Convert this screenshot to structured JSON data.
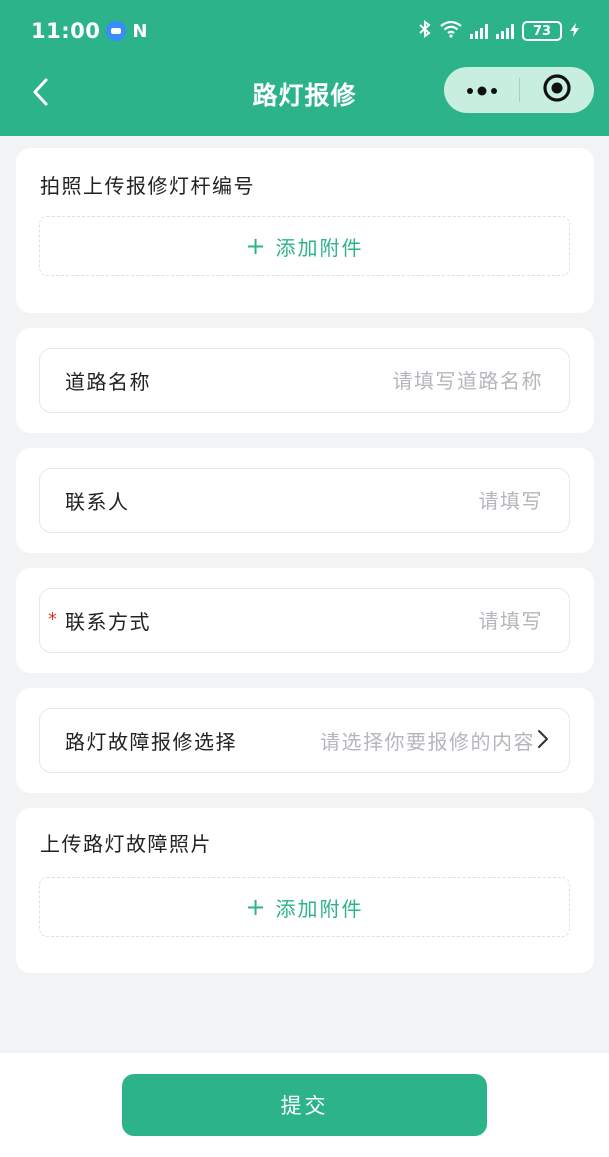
{
  "status_bar": {
    "time": "11:00",
    "nfc": "N",
    "battery": "73",
    "icons": [
      "message-icon",
      "nfc-icon",
      "bluetooth-icon",
      "wifi-icon",
      "signal-icon",
      "signal-icon",
      "battery-icon",
      "charging-icon"
    ]
  },
  "nav": {
    "title": "路灯报修",
    "back_icon": "chevron-left-icon",
    "more_icon": "more-dots-icon",
    "close_icon": "target-circle-icon"
  },
  "form": {
    "photo_section": {
      "title": "拍照上传报修灯杆编号",
      "add_attachment": "添加附件",
      "plus": "+"
    },
    "road_name": {
      "label": "道路名称",
      "placeholder": "请填写道路名称",
      "value": ""
    },
    "contact_person": {
      "label": "联系人",
      "placeholder": "请填写",
      "value": ""
    },
    "contact_method": {
      "required_mark": "*",
      "label": "联系方式",
      "placeholder": "请填写",
      "value": ""
    },
    "fault_select": {
      "label": "路灯故障报修选择",
      "placeholder": "请选择你要报修的内容"
    },
    "fault_photo_section": {
      "title": "上传路灯故障照片",
      "add_attachment": "添加附件",
      "plus": "+"
    }
  },
  "submit": {
    "label": "提交"
  },
  "colors": {
    "primary": "#2db38a",
    "required": "#e2332b",
    "placeholder": "#b3b6bb",
    "background": "#f2f3f5"
  }
}
